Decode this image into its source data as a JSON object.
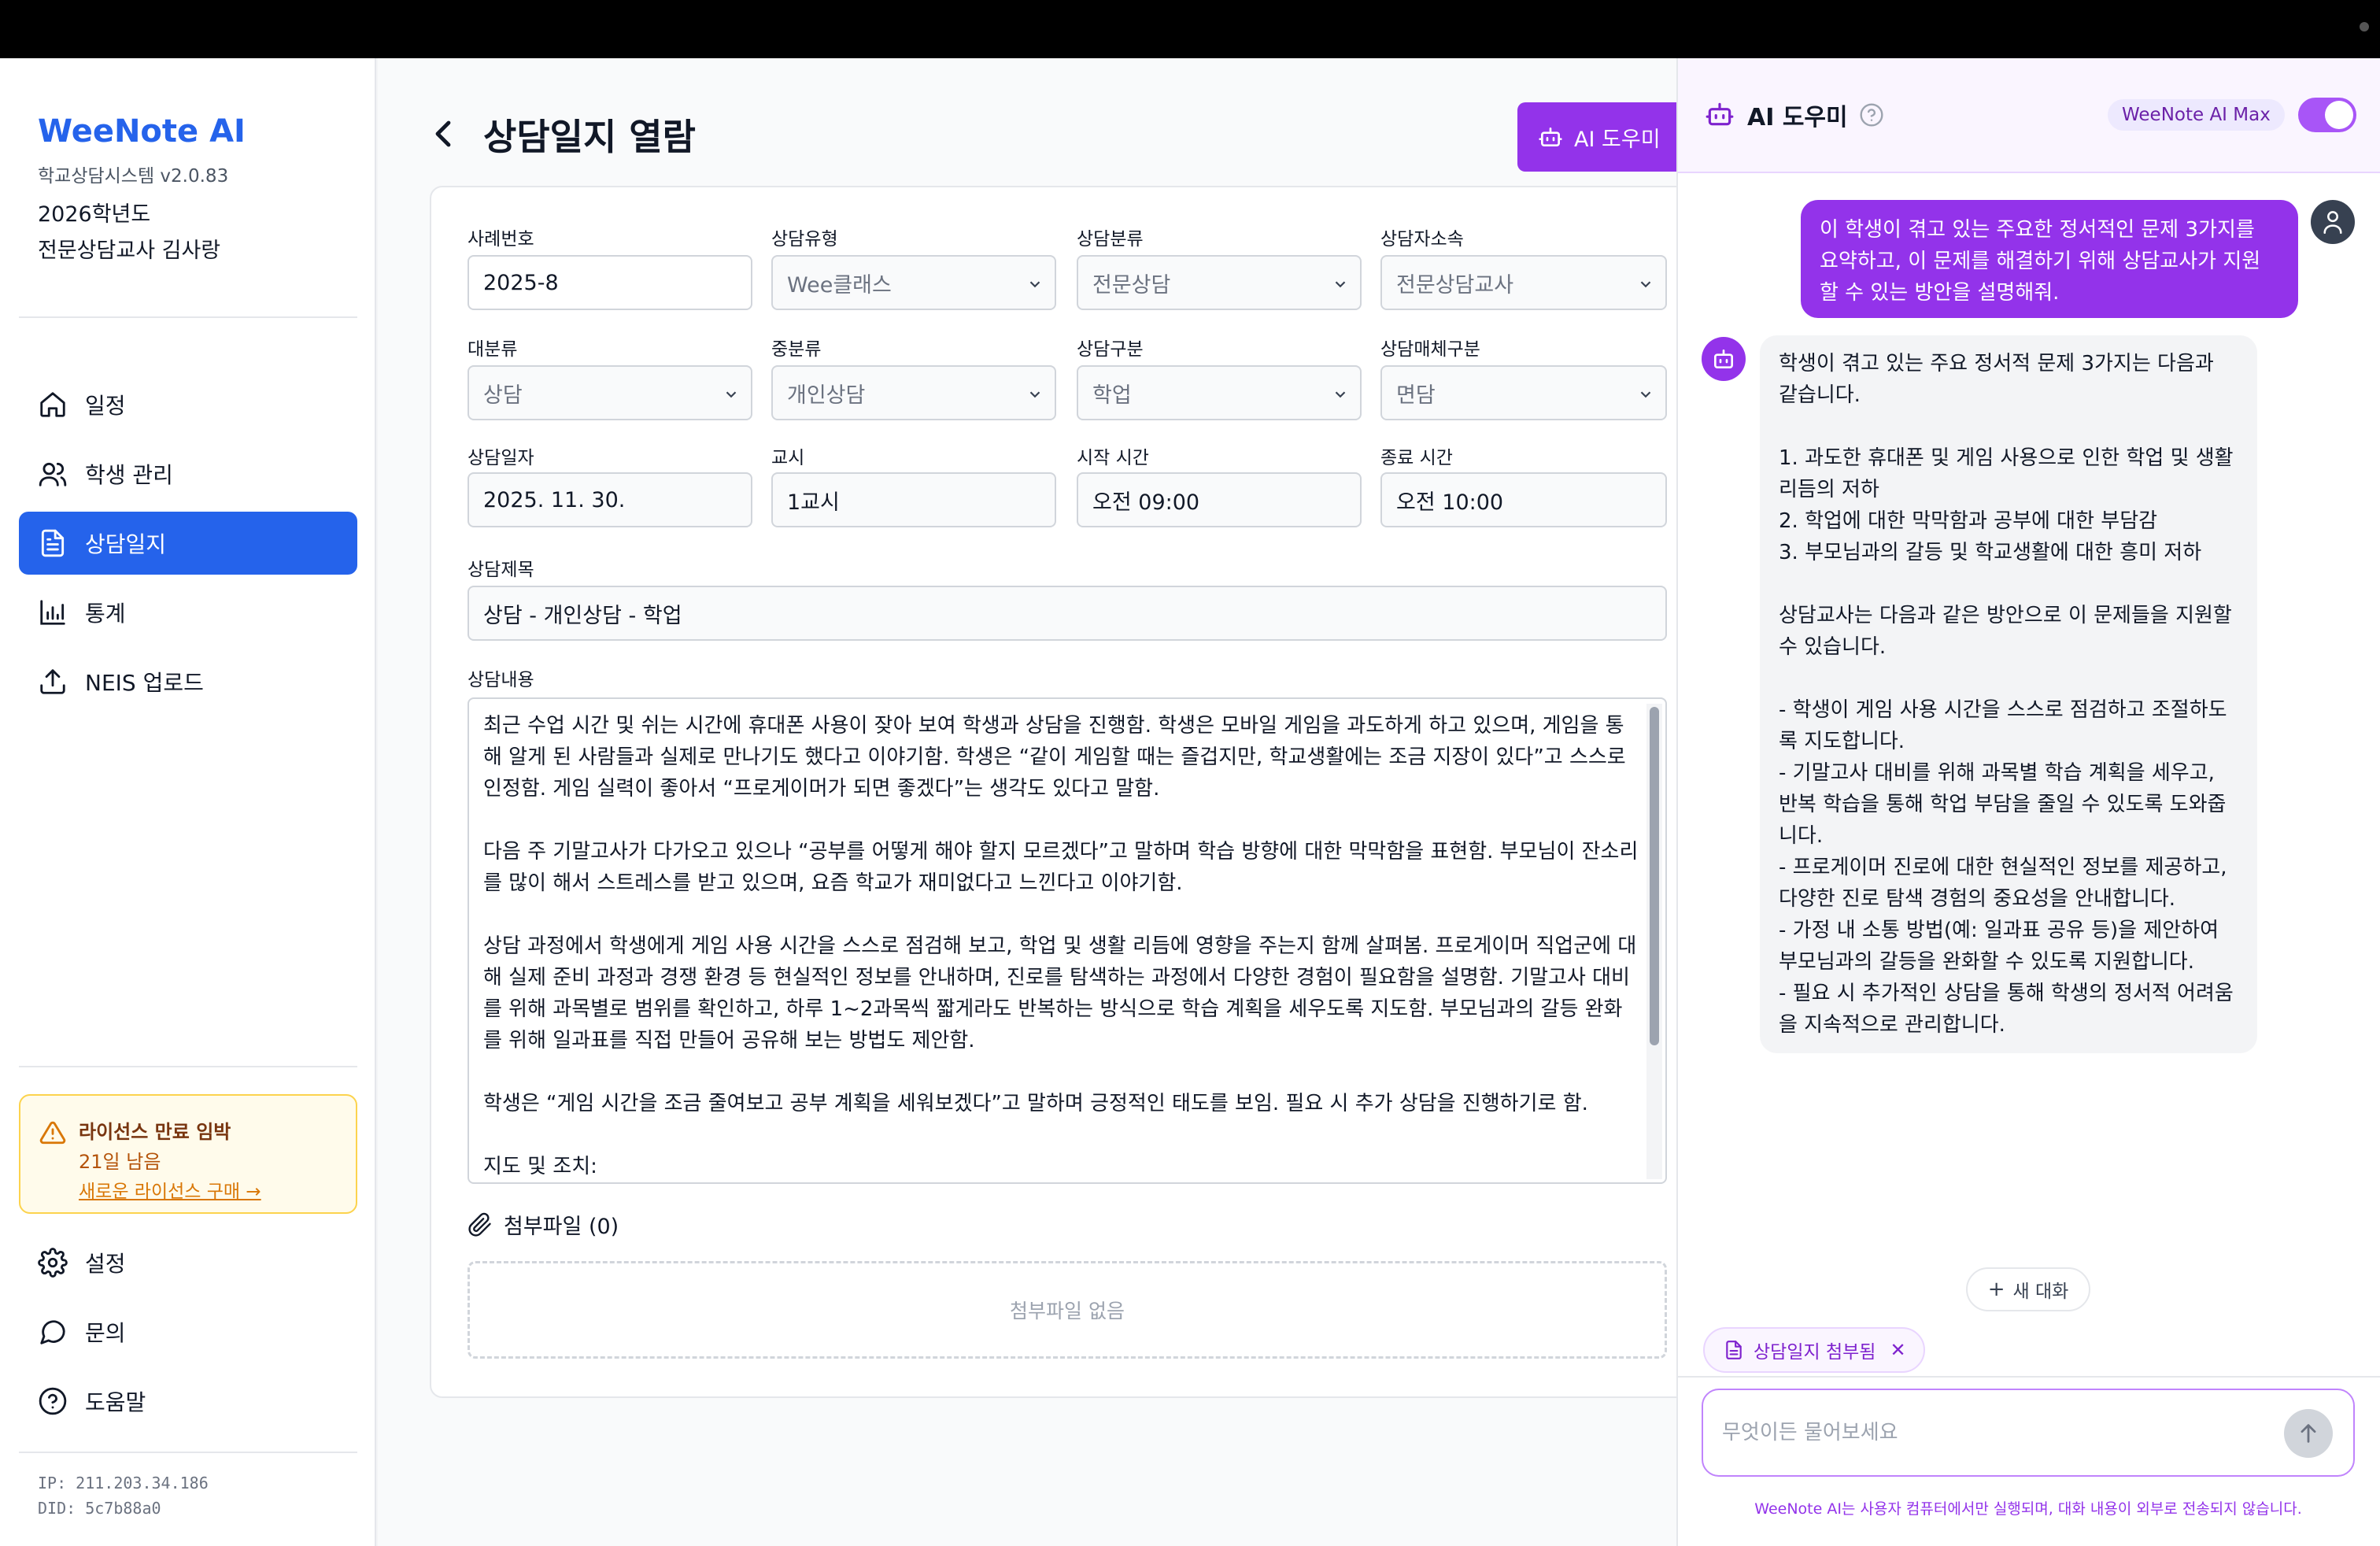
{
  "sidebar": {
    "brand": "WeeNote AI",
    "version": "학교상담시스템 v2.0.83",
    "year": "2026학년도",
    "teacher": "전문상담교사 김사랑",
    "nav": [
      {
        "label": "일정",
        "icon": "home-icon"
      },
      {
        "label": "학생 관리",
        "icon": "users-icon"
      },
      {
        "label": "상담일지",
        "icon": "document-icon",
        "active": true
      },
      {
        "label": "통계",
        "icon": "bar-chart-icon"
      },
      {
        "label": "NEIS 업로드",
        "icon": "upload-icon"
      }
    ],
    "license": {
      "title": "라이선스 만료 임박",
      "days": "21일 남음",
      "link": "새로운 라이선스 구매 →"
    },
    "bottom_nav": [
      {
        "label": "설정",
        "icon": "gear-icon"
      },
      {
        "label": "문의",
        "icon": "chat-icon"
      },
      {
        "label": "도움말",
        "icon": "help-circle-icon"
      }
    ],
    "ip": "IP: 211.203.34.186",
    "did": "DID: 5c7b88a0"
  },
  "main": {
    "title": "상담일지 열람",
    "ai_button": "AI 도우미",
    "fields": {
      "case_no_label": "사례번호",
      "case_no": "2025-8",
      "type_label": "상담유형",
      "type": "Wee클래스",
      "category_label": "상담분류",
      "category": "전문상담",
      "affiliation_label": "상담자소속",
      "affiliation": "전문상담교사",
      "major_label": "대분류",
      "major": "상담",
      "middle_label": "중분류",
      "middle": "개인상담",
      "division_label": "상담구분",
      "division": "학업",
      "medium_label": "상담매체구분",
      "medium": "면담",
      "date_label": "상담일자",
      "date": "2025. 11. 30.",
      "period_label": "교시",
      "period": "1교시",
      "start_label": "시작 시간",
      "start": "오전 09:00",
      "end_label": "종료 시간",
      "end": "오전 10:00",
      "subject_label": "상담제목",
      "subject": "상담 - 개인상담 - 학업",
      "content_label": "상담내용",
      "content": "최근 수업 시간 및 쉬는 시간에 휴대폰 사용이 잦아 보여 학생과 상담을 진행함. 학생은 모바일 게임을 과도하게 하고 있으며, 게임을 통해 알게 된 사람들과 실제로 만나기도 했다고 이야기함. 학생은 “같이 게임할 때는 즐겁지만, 학교생활에는 조금 지장이 있다”고 스스로 인정함. 게임 실력이 좋아서 “프로게이머가 되면 좋겠다”는 생각도 있다고 말함.\n\n다음 주 기말고사가 다가오고 있으나 “공부를 어떻게 해야 할지 모르겠다”고 말하며 학습 방향에 대한 막막함을 표현함. 부모님이 잔소리를 많이 해서 스트레스를 받고 있으며, 요즘 학교가 재미없다고 느낀다고 이야기함.\n\n상담 과정에서 학생에게 게임 사용 시간을 스스로 점검해 보고, 학업 및 생활 리듬에 영향을 주는지 함께 살펴봄. 프로게이머 직업군에 대해 실제 준비 과정과 경쟁 환경 등 현실적인 정보를 안내하며, 진로를 탐색하는 과정에서 다양한 경험이 필요함을 설명함. 기말고사 대비를 위해 과목별로 범위를 확인하고, 하루 1~2과목씩 짧게라도 반복하는 방식으로 학습 계획을 세우도록 지도함. 부모님과의 갈등 완화를 위해 일과표를 직접 만들어 공유해 보는 방법도 제안함.\n\n학생은 “게임 시간을 조금 줄여보고 공부 계획을 세워보겠다”고 말하며 긍정적인 태도를 보임. 필요 시 추가 상담을 진행하기로 함.\n\n지도 및 조치:"
    },
    "attachments_label": "첨부파일 (0)",
    "attachments_empty": "첨부파일 없음"
  },
  "panel": {
    "title": "AI 도우미",
    "badge": "WeeNote AI Max",
    "toggle_on": true,
    "user_message": "이 학생이 겪고 있는 주요한 정서적인 문제 3가지를 요약하고, 이 문제를 해결하기 위해 상담교사가 지원할 수 있는 방안을 설명해줘.",
    "bot_message": "학생이 겪고 있는 주요 정서적 문제 3가지는 다음과 같습니다.\n\n1. 과도한 휴대폰 및 게임 사용으로 인한 학업 및 생활 리듬의 저하\n2. 학업에 대한 막막함과 공부에 대한 부담감\n3. 부모님과의 갈등 및 학교생활에 대한 흥미 저하\n\n상담교사는 다음과 같은 방안으로 이 문제들을 지원할 수 있습니다.\n\n- 학생이 게임 사용 시간을 스스로 점검하고 조절하도록 지도합니다.\n- 기말고사 대비를 위해 과목별 학습 계획을 세우고, 반복 학습을 통해 학업 부담을 줄일 수 있도록 도와줍니다.\n- 프로게이머 진로에 대한 현실적인 정보를 제공하고, 다양한 진로 탐색 경험의 중요성을 안내합니다.\n- 가정 내 소통 방법(예: 일과표 공유 등)을 제안하여 부모님과의 갈등을 완화할 수 있도록 지원합니다.\n- 필요 시 추가적인 상담을 통해 학생의 정서적 어려움을 지속적으로 관리합니다.",
    "new_chat": "새 대화",
    "attach_chip": "상담일지 첨부됨",
    "input_placeholder": "무엇이든 물어보세요",
    "disclaimer": "WeeNote AI는 사용자 컴퓨터에서만 실행되며, 대화 내용이 외부로 전송되지 않습니다."
  }
}
